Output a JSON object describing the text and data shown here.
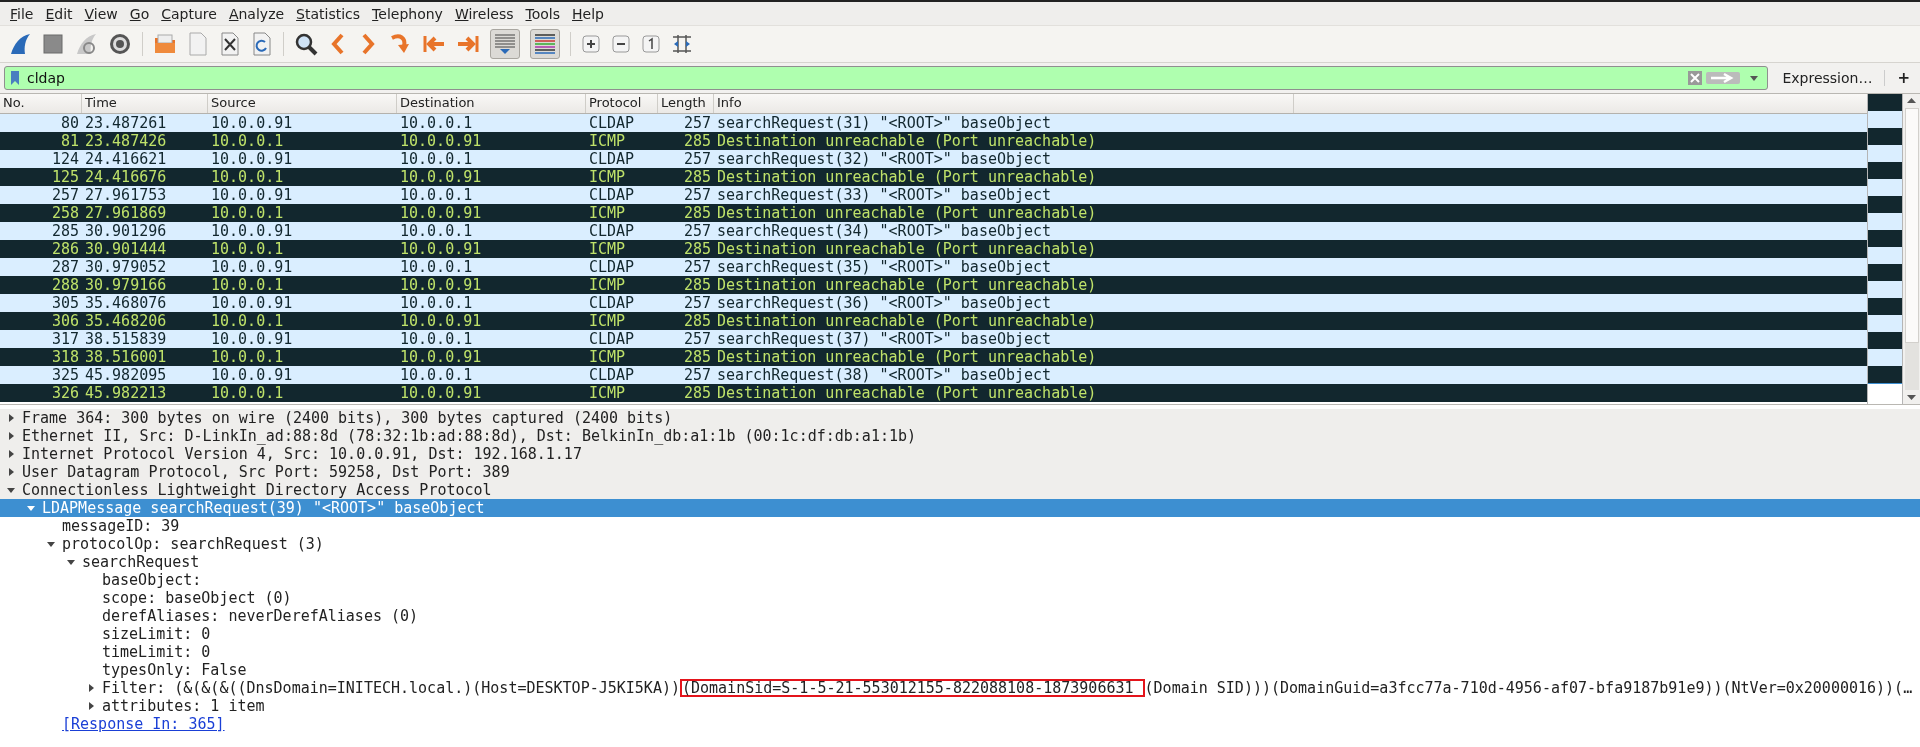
{
  "menu": [
    "File",
    "Edit",
    "View",
    "Go",
    "Capture",
    "Analyze",
    "Statistics",
    "Telephony",
    "Wireless",
    "Tools",
    "Help"
  ],
  "toolbar": {
    "autoscroll_pressed": true,
    "colorize_pressed": true
  },
  "filter": {
    "value": "cldap",
    "expression_button": "Expression…",
    "add_button": "+"
  },
  "packet_list": {
    "columns": [
      "No.",
      "Time",
      "Source",
      "Destination",
      "Protocol",
      "Length",
      "Info"
    ],
    "rows": [
      {
        "kind": "cldap",
        "cells": [
          "80",
          "23.487261",
          "10.0.0.91",
          "10.0.0.1",
          "CLDAP",
          "257",
          "searchRequest(31) \"<ROOT>\" baseObject"
        ]
      },
      {
        "kind": "icmp",
        "cells": [
          "81",
          "23.487426",
          "10.0.0.1",
          "10.0.0.91",
          "ICMP",
          "285",
          "Destination unreachable (Port unreachable)"
        ]
      },
      {
        "kind": "cldap",
        "cells": [
          "124",
          "24.416621",
          "10.0.0.91",
          "10.0.0.1",
          "CLDAP",
          "257",
          "searchRequest(32) \"<ROOT>\" baseObject"
        ]
      },
      {
        "kind": "icmp",
        "cells": [
          "125",
          "24.416676",
          "10.0.0.1",
          "10.0.0.91",
          "ICMP",
          "285",
          "Destination unreachable (Port unreachable)"
        ]
      },
      {
        "kind": "cldap",
        "cells": [
          "257",
          "27.961753",
          "10.0.0.91",
          "10.0.0.1",
          "CLDAP",
          "257",
          "searchRequest(33) \"<ROOT>\" baseObject"
        ]
      },
      {
        "kind": "icmp",
        "cells": [
          "258",
          "27.961869",
          "10.0.0.1",
          "10.0.0.91",
          "ICMP",
          "285",
          "Destination unreachable (Port unreachable)"
        ]
      },
      {
        "kind": "cldap",
        "cells": [
          "285",
          "30.901296",
          "10.0.0.91",
          "10.0.0.1",
          "CLDAP",
          "257",
          "searchRequest(34) \"<ROOT>\" baseObject"
        ]
      },
      {
        "kind": "icmp",
        "cells": [
          "286",
          "30.901444",
          "10.0.0.1",
          "10.0.0.91",
          "ICMP",
          "285",
          "Destination unreachable (Port unreachable)"
        ]
      },
      {
        "kind": "cldap",
        "cells": [
          "287",
          "30.979052",
          "10.0.0.91",
          "10.0.0.1",
          "CLDAP",
          "257",
          "searchRequest(35) \"<ROOT>\" baseObject"
        ]
      },
      {
        "kind": "icmp",
        "cells": [
          "288",
          "30.979166",
          "10.0.0.1",
          "10.0.0.91",
          "ICMP",
          "285",
          "Destination unreachable (Port unreachable)"
        ]
      },
      {
        "kind": "cldap",
        "cells": [
          "305",
          "35.468076",
          "10.0.0.91",
          "10.0.0.1",
          "CLDAP",
          "257",
          "searchRequest(36) \"<ROOT>\" baseObject"
        ]
      },
      {
        "kind": "icmp",
        "cells": [
          "306",
          "35.468206",
          "10.0.0.1",
          "10.0.0.91",
          "ICMP",
          "285",
          "Destination unreachable (Port unreachable)"
        ]
      },
      {
        "kind": "cldap",
        "cells": [
          "317",
          "38.515839",
          "10.0.0.91",
          "10.0.0.1",
          "CLDAP",
          "257",
          "searchRequest(37) \"<ROOT>\" baseObject"
        ]
      },
      {
        "kind": "icmp",
        "cells": [
          "318",
          "38.516001",
          "10.0.0.1",
          "10.0.0.91",
          "ICMP",
          "285",
          "Destination unreachable (Port unreachable)"
        ]
      },
      {
        "kind": "cldap",
        "cells": [
          "325",
          "45.982095",
          "10.0.0.91",
          "10.0.0.1",
          "CLDAP",
          "257",
          "searchRequest(38) \"<ROOT>\" baseObject"
        ]
      },
      {
        "kind": "icmp",
        "cells": [
          "326",
          "45.982213",
          "10.0.0.1",
          "10.0.0.91",
          "ICMP",
          "285",
          "Destination unreachable (Port unreachable)"
        ]
      }
    ]
  },
  "details": [
    {
      "text": "Frame 364: 300 bytes on wire (2400 bits), 300 bytes captured (2400 bits)",
      "expanded": false,
      "selected": false
    },
    {
      "text": "Ethernet II, Src: D-LinkIn_ad:88:8d (78:32:1b:ad:88:8d), Dst: BelkinIn_db:a1:1b (00:1c:df:db:a1:1b)",
      "expanded": false,
      "selected": false
    },
    {
      "text": "Internet Protocol Version 4, Src: 10.0.0.91, Dst: 192.168.1.17",
      "expanded": false,
      "selected": false
    },
    {
      "text": "User Datagram Protocol, Src Port: 59258, Dst Port: 389",
      "expanded": false,
      "selected": false
    },
    {
      "text": "Connectionless Lightweight Directory Access Protocol",
      "expanded": true,
      "selected": false,
      "children": [
        {
          "text": "LDAPMessage searchRequest(39) \"<ROOT>\" baseObject",
          "expanded": true,
          "selected": true,
          "children": [
            {
              "text": "messageID: 39",
              "selected": false
            },
            {
              "text": "protocolOp: searchRequest (3)",
              "expanded": true,
              "selected": false,
              "children": [
                {
                  "text": "searchRequest",
                  "expanded": true,
                  "selected": false,
                  "children": [
                    {
                      "text": "baseObject:",
                      "selected": false
                    },
                    {
                      "text": "scope: baseObject (0)",
                      "selected": false
                    },
                    {
                      "text": "derefAliases: neverDerefAliases (0)",
                      "selected": false
                    },
                    {
                      "text": "sizeLimit: 0",
                      "selected": false
                    },
                    {
                      "text": "timeLimit: 0",
                      "selected": false
                    },
                    {
                      "text": "typesOnly: False",
                      "selected": false
                    },
                    {
                      "text": "Filter: (&(&(&((DnsDomain=INITECH.local.)(Host=DESKTOP-J5KI5KA))",
                      "boxed": "(DomainSid=S-1-5-21-553012155-822088108-1873906631 ",
                      "after": "(Domain SID)))(DomainGuid=a3fcc77a-710d-4956-af07-bfa9187b91e9))(NtVer=0x20000016))(…",
                      "expanded": false,
                      "selected": false
                    },
                    {
                      "text": "attributes: 1 item",
                      "expanded": false,
                      "selected": false
                    }
                  ]
                }
              ]
            },
            {
              "kind": "link",
              "text": "[Response In: 365]",
              "selected": false
            }
          ]
        }
      ]
    }
  ]
}
